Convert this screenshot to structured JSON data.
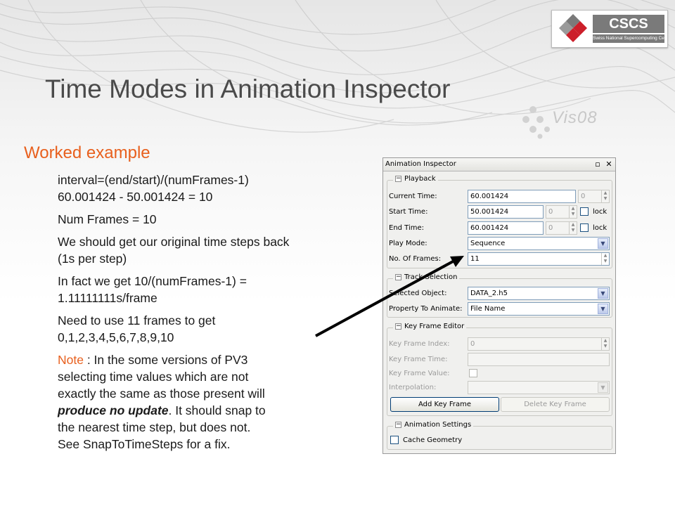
{
  "logo": {
    "text": "CSCS",
    "subtitle": "Swiss National Supercomputing Centre"
  },
  "title": "Time Modes in Animation Inspector",
  "vis_logo_text": "Vis08",
  "subhead": "Worked example",
  "body": {
    "p1": [
      "interval=(end/start)/(numFrames-1)",
      "60.001424 - 50.001424 = 10"
    ],
    "p2": [
      "Num Frames = 10"
    ],
    "p3": [
      "We should get our original time steps back",
      "(1s per step)"
    ],
    "p4": [
      "In fact we get 10/(numFrames-1) =",
      "1.11111111s/frame"
    ],
    "p5": [
      "Need to use 11 frames to get",
      "0,1,2,3,4,5,6,7,8,9,10"
    ],
    "p6": {
      "note_label": "Note",
      "line1_rest": " : In the some versions of PV3",
      "line2": "selecting time values which are not",
      "line3": "exactly the same as those present will",
      "line4_em": "produce no update",
      "line4_rest": ". It should snap to",
      "line5": "the nearest time step, but does not.",
      "line6": "See SnapToTimeSteps for a fix."
    }
  },
  "panel": {
    "title": "Animation Inspector",
    "float_icon": "▫",
    "close_icon": "✕",
    "playback": {
      "label": "Playback",
      "current_time_label": "Current Time:",
      "current_time": "60.001424",
      "current_index": "0",
      "start_time_label": "Start Time:",
      "start_time": "50.001424",
      "start_index": "0",
      "end_time_label": "End Time:",
      "end_time": "60.001424",
      "end_index": "0",
      "lock_label": "lock",
      "play_mode_label": "Play Mode:",
      "play_mode": "Sequence",
      "frames_label": "No. Of Frames:",
      "frames": "11"
    },
    "track": {
      "label": "Track Selection",
      "object_label": "Selected Object:",
      "object": "DATA_2.h5",
      "property_label": "Property To Animate:",
      "property": "File Name"
    },
    "keyframe": {
      "label": "Key Frame Editor",
      "index_label": "Key Frame Index:",
      "index": "0",
      "time_label": "Key Frame Time:",
      "value_label": "Key Frame Value:",
      "interp_label": "Interpolation:",
      "add_button": "Add Key Frame",
      "delete_button": "Delete Key Frame"
    },
    "settings": {
      "label": "Animation Settings",
      "cache_label": "Cache Geometry"
    }
  }
}
